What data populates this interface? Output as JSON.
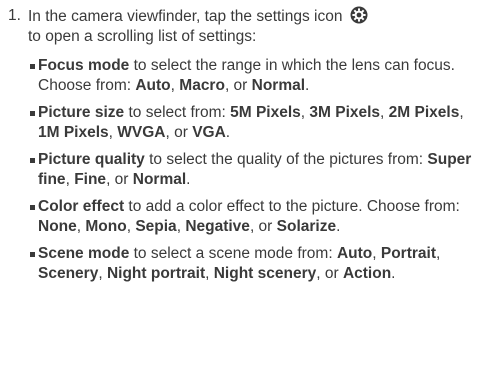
{
  "step": {
    "number": "1.",
    "text_before_icon": "In the camera viewfinder, tap the settings icon",
    "icon": "settings-icon",
    "text_after_icon": "to open a scrolling list of settings:"
  },
  "bullets": [
    {
      "segments": [
        {
          "text": "Focus mode",
          "bold": true
        },
        {
          "text": " to select the range in which the lens can focus. Choose from: ",
          "bold": false
        },
        {
          "text": "Auto",
          "bold": true
        },
        {
          "text": ", ",
          "bold": false
        },
        {
          "text": "Macro",
          "bold": true
        },
        {
          "text": ", or ",
          "bold": false
        },
        {
          "text": "Normal",
          "bold": true
        },
        {
          "text": ".",
          "bold": false
        }
      ]
    },
    {
      "segments": [
        {
          "text": "Picture size",
          "bold": true
        },
        {
          "text": " to select from: ",
          "bold": false
        },
        {
          "text": "5M Pixels",
          "bold": true
        },
        {
          "text": ", ",
          "bold": false
        },
        {
          "text": "3M Pixels",
          "bold": true
        },
        {
          "text": ", ",
          "bold": false
        },
        {
          "text": "2M Pixels",
          "bold": true
        },
        {
          "text": ", ",
          "bold": false
        },
        {
          "text": "1M Pixels",
          "bold": true
        },
        {
          "text": ", ",
          "bold": false
        },
        {
          "text": "WVGA",
          "bold": true
        },
        {
          "text": ", or ",
          "bold": false
        },
        {
          "text": "VGA",
          "bold": true
        },
        {
          "text": ".",
          "bold": false
        }
      ]
    },
    {
      "segments": [
        {
          "text": "Picture quality",
          "bold": true
        },
        {
          "text": " to select the quality of the pictures from: ",
          "bold": false
        },
        {
          "text": "Super fine",
          "bold": true
        },
        {
          "text": ", ",
          "bold": false
        },
        {
          "text": "Fine",
          "bold": true
        },
        {
          "text": ", or ",
          "bold": false
        },
        {
          "text": "Normal",
          "bold": true
        },
        {
          "text": ".",
          "bold": false
        }
      ]
    },
    {
      "segments": [
        {
          "text": "Color effect",
          "bold": true
        },
        {
          "text": " to add a color effect to the picture. Choose from: ",
          "bold": false
        },
        {
          "text": "None",
          "bold": true
        },
        {
          "text": ", ",
          "bold": false
        },
        {
          "text": "Mono",
          "bold": true
        },
        {
          "text": ", ",
          "bold": false
        },
        {
          "text": "Sepia",
          "bold": true
        },
        {
          "text": ", ",
          "bold": false
        },
        {
          "text": "Negative",
          "bold": true
        },
        {
          "text": ", or ",
          "bold": false
        },
        {
          "text": "Solarize",
          "bold": true
        },
        {
          "text": ".",
          "bold": false
        }
      ]
    },
    {
      "segments": [
        {
          "text": "Scene mode",
          "bold": true
        },
        {
          "text": " to select a scene mode from: ",
          "bold": false
        },
        {
          "text": "Auto",
          "bold": true
        },
        {
          "text": ", ",
          "bold": false
        },
        {
          "text": "Portrait",
          "bold": true
        },
        {
          "text": ", ",
          "bold": false
        },
        {
          "text": "Scenery",
          "bold": true
        },
        {
          "text": ", ",
          "bold": false
        },
        {
          "text": "Night portrait",
          "bold": true
        },
        {
          "text": ", ",
          "bold": false
        },
        {
          "text": "Night scenery",
          "bold": true
        },
        {
          "text": ", or ",
          "bold": false
        },
        {
          "text": "Action",
          "bold": true
        },
        {
          "text": ".",
          "bold": false
        }
      ]
    }
  ],
  "colors": {
    "text": "#3a3a3a",
    "icon": "#3a3a3a"
  }
}
